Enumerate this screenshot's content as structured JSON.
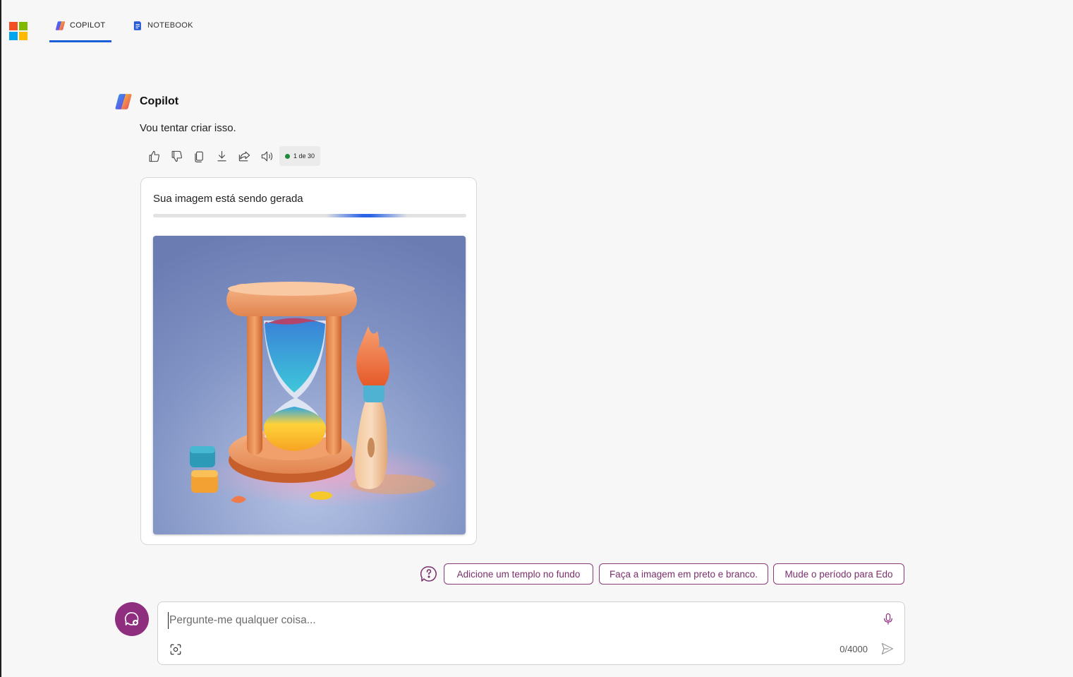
{
  "nav": {
    "tabs": [
      {
        "label": "COPILOT",
        "active": true
      },
      {
        "label": "NOTEBOOK",
        "active": false
      }
    ]
  },
  "colors": {
    "accent_blue": "#1a5fd8",
    "brand_purple": "#8f2d7e",
    "chip_text": "#7a2f6b",
    "status_green": "#1e8a3a"
  },
  "message": {
    "sender": "Copilot",
    "text": "Vou tentar criar isso.",
    "counter": "1 de 30",
    "actions": [
      "thumbs-up-icon",
      "thumbs-down-icon",
      "copy-icon",
      "download-icon",
      "share-icon",
      "speaker-icon"
    ]
  },
  "image_card": {
    "title": "Sua imagem está sendo gerada",
    "progress_indeterminate": true
  },
  "suggestions": [
    "Adicione um templo no fundo",
    "Faça a imagem em preto e branco.",
    "Mude o período para Edo"
  ],
  "composer": {
    "placeholder": "Pergunte-me qualquer coisa...",
    "char_count": "0/4000"
  }
}
